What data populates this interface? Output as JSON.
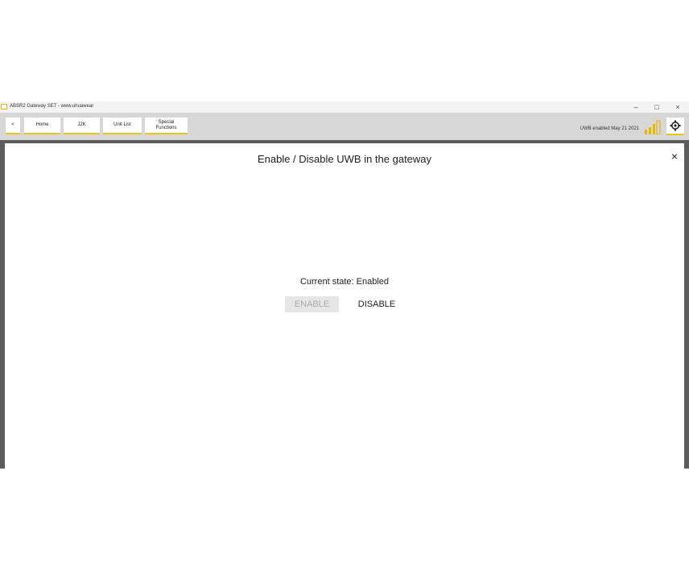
{
  "window": {
    "title": "ABSR2 Gateway SET - www.uhuawear",
    "min_glyph": "–",
    "max_glyph": "□",
    "close_glyph": "×"
  },
  "toolbar": {
    "back_label": "<",
    "buttons": [
      {
        "label": "Home"
      },
      {
        "label": "J2K"
      },
      {
        "label": "Unit List"
      },
      {
        "label": "Special\nFunctions"
      }
    ],
    "status_text": "UWB enabled May 21 2021",
    "signal_icon": "signal-bars-icon",
    "settings_icon": "gear-icon",
    "accent_color": "#f0c419"
  },
  "dialog": {
    "title": "Enable / Disable UWB in the gateway",
    "close_glyph": "×",
    "state_text": "Current state: Enabled",
    "enable_label": "ENABLE",
    "disable_label": "DISABLE"
  }
}
